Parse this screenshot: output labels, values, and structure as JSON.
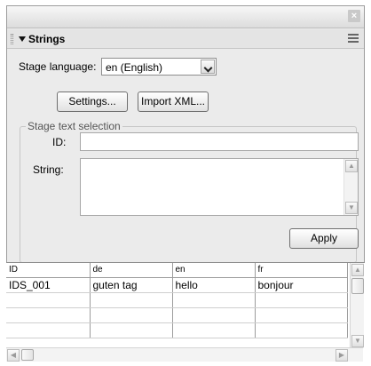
{
  "window": {
    "close_glyph": "×"
  },
  "panel": {
    "title": "Strings",
    "options_icon": "menu-lines-icon"
  },
  "stage_language": {
    "label": "Stage language:",
    "value": "en (English)"
  },
  "buttons": {
    "settings": "Settings...",
    "import_xml": "Import XML...",
    "apply": "Apply"
  },
  "stage_text_selection": {
    "legend": "Stage text selection",
    "id_label": "ID:",
    "id_value": "",
    "string_label": "String:",
    "string_value": ""
  },
  "table": {
    "columns": [
      "ID",
      "de",
      "en",
      "fr"
    ],
    "rows": [
      [
        "IDS_001",
        "guten tag",
        "hello",
        "bonjour"
      ]
    ]
  },
  "colors": {
    "panel_bg": "#ebebeb",
    "border": "#9c9c9c"
  }
}
